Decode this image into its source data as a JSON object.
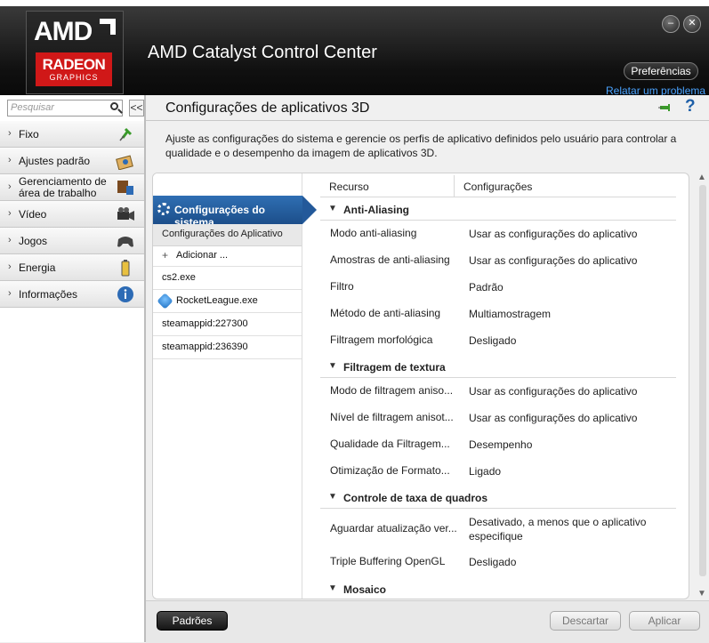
{
  "header": {
    "logo_amd": "AMD",
    "logo_radeon": "RADEON",
    "logo_graphics": "GRAPHICS",
    "title": "AMD Catalyst Control Center",
    "preferences_label": "Preferências",
    "report_link": "Relatar um problema"
  },
  "sidebar": {
    "search_placeholder": "Pesquisar",
    "collapse_label": "<<",
    "items": [
      {
        "label": "Fixo",
        "icon": "pin-icon"
      },
      {
        "label": "Ajustes padrão",
        "icon": "presets-icon"
      },
      {
        "label": "Gerenciamento de área de trabalho",
        "label_line1": "Gerenciamento de",
        "label_line2": "área de trabalho",
        "icon": "desktop-icon"
      },
      {
        "label": "Vídeo",
        "icon": "video-camera-icon"
      },
      {
        "label": "Jogos",
        "icon": "gamepad-icon"
      },
      {
        "label": "Energia",
        "icon": "battery-icon"
      },
      {
        "label": "Informações",
        "icon": "info-icon"
      }
    ]
  },
  "main": {
    "page_title": "Configurações de aplicativos 3D",
    "description": "Ajuste as configurações do sistema e gerencie os perfis de aplicativo definidos pelo usuário para controlar a qualidade e o desempenho da imagem de aplicativos 3D.",
    "system_tab": "Configurações do sistema",
    "app_settings_header": "Configurações do Aplicativo",
    "add_label": "Adicionar ...",
    "apps": [
      "cs2.exe",
      "RocketLeague.exe",
      "steamappid:227300",
      "steamappid:236390"
    ],
    "columns": {
      "feature": "Recurso",
      "settings": "Configurações"
    },
    "sections": [
      {
        "title": "Anti-Aliasing",
        "rows": [
          {
            "k": "Modo anti-aliasing",
            "v": "Usar as configurações do aplicativo"
          },
          {
            "k": "Amostras de anti-aliasing",
            "v": "Usar as configurações do aplicativo"
          },
          {
            "k": "Filtro",
            "v": "Padrão"
          },
          {
            "k": "Método de anti-aliasing",
            "v": "Multiamostragem"
          },
          {
            "k": "Filtragem morfológica",
            "v": "Desligado"
          }
        ]
      },
      {
        "title": "Filtragem de textura",
        "rows": [
          {
            "k": "Modo de filtragem aniso...",
            "v": "Usar as configurações do aplicativo"
          },
          {
            "k": "Nível de filtragem anisot...",
            "v": "Usar as configurações do aplicativo"
          },
          {
            "k": "Qualidade da Filtragem...",
            "v": "Desempenho"
          },
          {
            "k": "Otimização de Formato...",
            "v": "Ligado"
          }
        ]
      },
      {
        "title": "Controle de taxa de quadros",
        "rows": [
          {
            "k": "Aguardar atualização ver...",
            "v": "Desativado, a menos que o aplicativo especifique"
          },
          {
            "k": "Triple Buffering OpenGL",
            "v": "Desligado"
          }
        ]
      },
      {
        "title": "Mosaico",
        "rows": []
      }
    ],
    "buttons": {
      "defaults": "Padrões",
      "discard": "Descartar",
      "apply": "Aplicar"
    }
  },
  "colors": {
    "accent_blue": "#1c4e8a",
    "radeon_red": "#d01818",
    "link_blue": "#4aa3ff"
  }
}
